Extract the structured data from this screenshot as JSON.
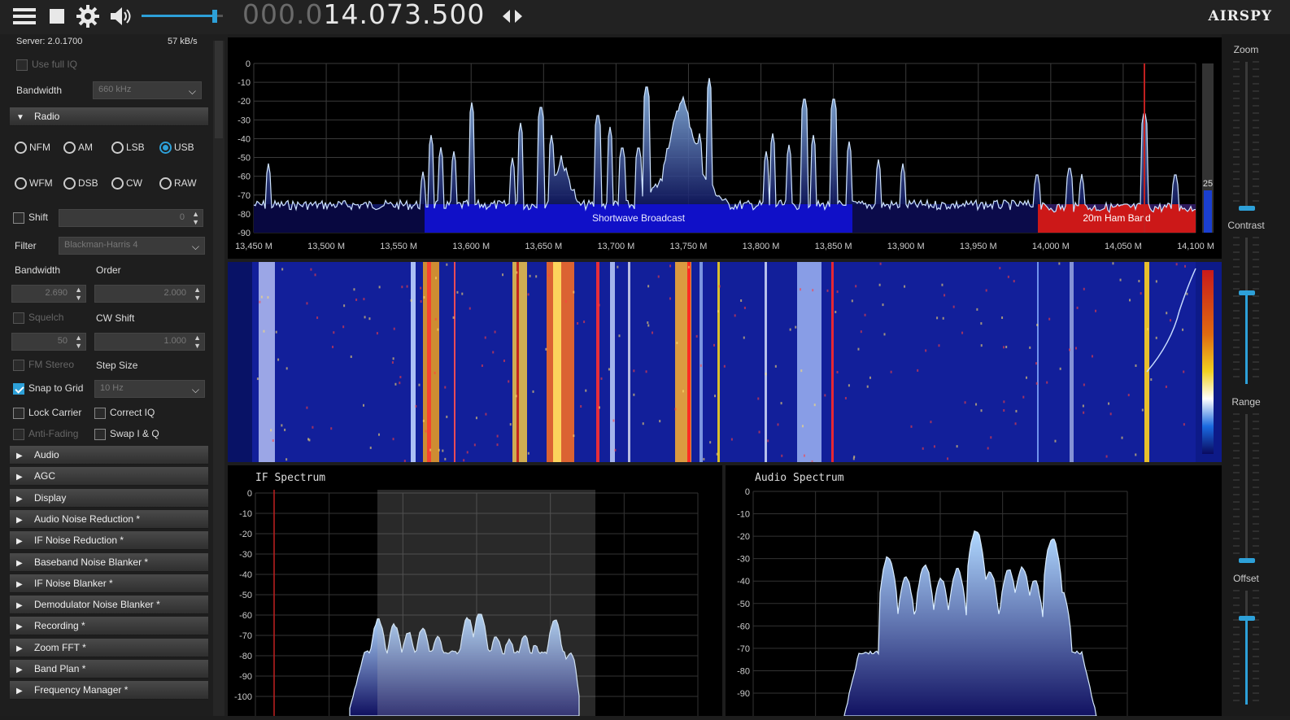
{
  "toolbar": {
    "frequency_dim": "000.0",
    "frequency_lit": "14.073.500",
    "brand": "AIRSPY",
    "icons": [
      "menu-icon",
      "stop-icon",
      "gear-icon",
      "speaker-icon",
      "swap-arrows-icon"
    ],
    "volume_level": 0.9
  },
  "sidebar": {
    "server": "Server: 2.0.1700",
    "rate": "57 kB/s",
    "use_full_iq": "Use full IQ",
    "bandwidth_label": "Bandwidth",
    "bandwidth_value": "660 kHz",
    "radio_section": "Radio",
    "modes": [
      "NFM",
      "AM",
      "LSB",
      "USB",
      "WFM",
      "DSB",
      "CW",
      "RAW"
    ],
    "selected_mode": "USB",
    "shift_label": "Shift",
    "shift_value": "0",
    "filter_label": "Filter",
    "filter_value": "Blackman-Harris 4",
    "bw_label": "Bandwidth",
    "order_label": "Order",
    "bw_value": "2.690",
    "order_value": "2.000",
    "squelch_label": "Squelch",
    "cwshift_label": "CW Shift",
    "squelch_value": "50",
    "cwshift_value": "1.000",
    "fmstereo_label": "FM Stereo",
    "stepsize_label": "Step Size",
    "snap_label": "Snap to Grid",
    "step_value": "10 Hz",
    "lock_label": "Lock Carrier",
    "correctiq_label": "Correct IQ",
    "antifading_label": "Anti-Fading",
    "swapiq_label": "Swap I & Q",
    "sections": [
      "Audio",
      "AGC",
      "Display",
      "Audio Noise Reduction *",
      "IF Noise Reduction *",
      "Baseband Noise Blanker *",
      "IF Noise Blanker *",
      "Demodulator Noise Blanker *",
      "Recording *",
      "Zoom FFT *",
      "Band Plan *",
      "Frequency Manager *"
    ]
  },
  "spectrum": {
    "ylabels": [
      "0",
      "-10",
      "-20",
      "-30",
      "-40",
      "-50",
      "-60",
      "-70",
      "-80",
      "-90"
    ],
    "xlabels": [
      "13,450 M",
      "13,500 M",
      "13,550 M",
      "13,600 M",
      "13,650 M",
      "13,700 M",
      "13,750 M",
      "13,800 M",
      "13,850 M",
      "13,900 M",
      "13,950 M",
      "14,000 M",
      "14,050 M",
      "14,100 M"
    ],
    "band_shortwave": "Shortwave Broadcast",
    "band_ham": "20m Ham Band",
    "level_readout": "25",
    "colors": {
      "band_blue": "#1010c8",
      "band_red": "#cc1818",
      "trace": "#cfe4ff",
      "grid": "#3a3a3a"
    }
  },
  "if_panel": {
    "title": "IF Spectrum",
    "ylabels": [
      "0",
      "-10",
      "-20",
      "-30",
      "-40",
      "-50",
      "-60",
      "-70",
      "-80",
      "-90",
      "-100"
    ]
  },
  "audio_panel": {
    "title": "Audio Spectrum",
    "ylabels": [
      "0",
      "-10",
      "-20",
      "-30",
      "-40",
      "-50",
      "-60",
      "-70",
      "-80",
      "-90"
    ]
  },
  "right_panel": {
    "zoom": "Zoom",
    "contrast": "Contrast",
    "range": "Range",
    "offset": "Offset",
    "zoom_level": 0.0,
    "contrast_level": 0.62,
    "range_level": 0.0,
    "offset_level": 0.76
  }
}
